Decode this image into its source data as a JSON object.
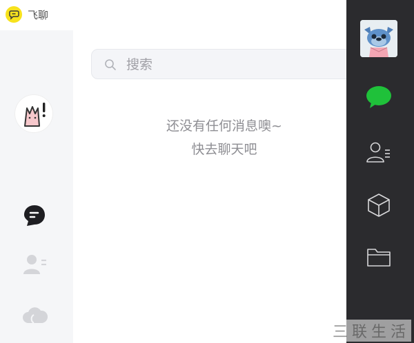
{
  "app": {
    "name": "飞聊",
    "logo_icon": "chat-bubble-logo-icon",
    "logo_color": "#f7e21d"
  },
  "search": {
    "placeholder": "搜索"
  },
  "empty_state": {
    "line1": "还没有任何消息噢~",
    "line2": "快去聊天吧"
  },
  "left_nav": {
    "items": [
      {
        "icon": "chat-icon",
        "active": true
      },
      {
        "icon": "contacts-icon",
        "active": false
      },
      {
        "icon": "cloud-icon",
        "active": false
      }
    ]
  },
  "right_nav": {
    "items": [
      {
        "icon": "message-icon",
        "active": true,
        "color": "#1fc13a"
      },
      {
        "icon": "contacts-icon",
        "active": false
      },
      {
        "icon": "cube-icon",
        "active": false
      },
      {
        "icon": "folder-icon",
        "active": false
      }
    ]
  },
  "watermark": "三联生活",
  "colors": {
    "sidebar_bg": "#f5f6f8",
    "dark_bar": "#2b2b2e",
    "accent_green": "#1fc13a"
  }
}
